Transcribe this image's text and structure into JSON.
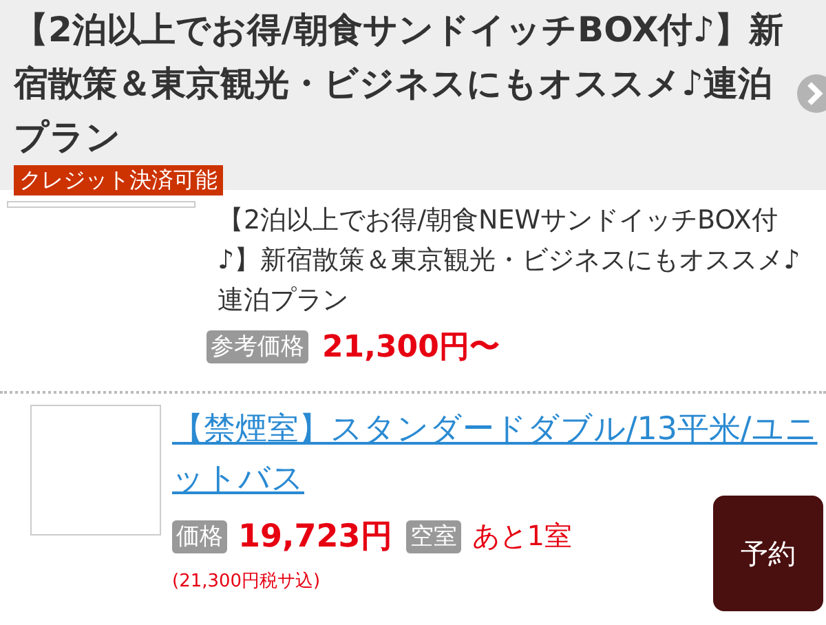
{
  "header": {
    "title": "【2泊以上でお得/朝食サンドイッチBOX付♪】新宿散策＆東京観光・ビジネスにもオススメ♪連泊プラン",
    "badge": "クレジット決済可能"
  },
  "plan": {
    "title": "【2泊以上でお得/朝食NEWサンドイッチBOX付♪】新宿散策＆東京観光・ビジネスにもオススメ♪連泊プラン",
    "price_label": "参考価格",
    "price": "21,300円〜"
  },
  "rooms": [
    {
      "name": "【禁煙室】スタンダードダブル/13平米/ユニットバス",
      "price_label": "価格",
      "price": "19,723円",
      "vacancy_label": "空室",
      "vacancy": "あと1室",
      "tax_note": "(21,300円税サ込)",
      "button": "予約"
    }
  ]
}
